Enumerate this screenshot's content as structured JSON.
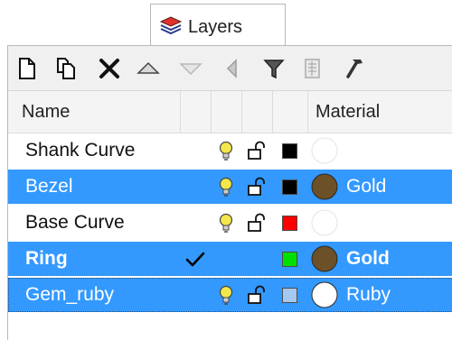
{
  "tab": {
    "label": "Layers",
    "icon": "layers-icon"
  },
  "toolbar": {
    "buttons": [
      {
        "name": "new-layer-button",
        "icon": "new-document-icon"
      },
      {
        "name": "new-sublayer-button",
        "icon": "copy-icon"
      },
      {
        "name": "delete-layer-button",
        "icon": "delete-x-icon"
      },
      {
        "name": "move-up-button",
        "icon": "triangle-up-icon"
      },
      {
        "name": "move-down-button",
        "icon": "triangle-down-icon"
      },
      {
        "name": "move-out-button",
        "icon": "triangle-left-icon"
      },
      {
        "name": "filter-button",
        "icon": "funnel-icon"
      },
      {
        "name": "layer-states-button",
        "icon": "grid-doc-icon"
      },
      {
        "name": "tools-button",
        "icon": "hammer-icon"
      }
    ]
  },
  "header": {
    "name": "Name",
    "material": "Material"
  },
  "layers": [
    {
      "name": "Shank Curve",
      "selected": false,
      "current": false,
      "visible": true,
      "locked": false,
      "color": "#000000",
      "material": "",
      "material_color": "#ffffff"
    },
    {
      "name": "Bezel",
      "selected": true,
      "current": false,
      "visible": true,
      "locked": false,
      "color": "#000000",
      "material": "Gold",
      "material_color": "#6b5028"
    },
    {
      "name": "Base Curve",
      "selected": false,
      "current": false,
      "visible": true,
      "locked": false,
      "color": "#ff0000",
      "material": "",
      "material_color": "#ffffff"
    },
    {
      "name": "Ring",
      "selected": true,
      "current": true,
      "visible": true,
      "locked": false,
      "color": "#00e000",
      "material": "Gold",
      "material_color": "#6b5028"
    },
    {
      "name": "Gem_ruby",
      "selected": true,
      "current": false,
      "visible": true,
      "locked": false,
      "color": "#a4c8f0",
      "material": "Ruby",
      "material_color": "#ffffff"
    }
  ],
  "colors": {
    "selection": "#3399ff",
    "bulb": "#f2e84a"
  }
}
